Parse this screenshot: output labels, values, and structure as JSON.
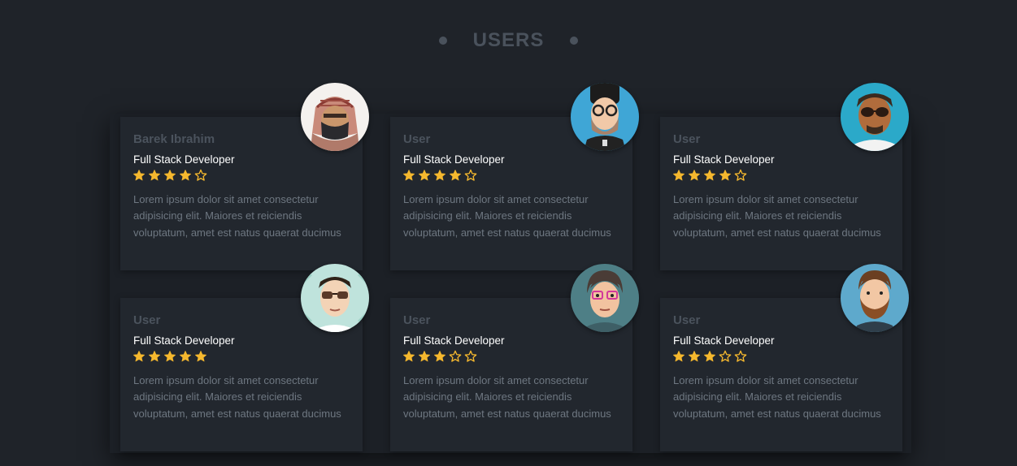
{
  "section": {
    "title": "USERS"
  },
  "colors": {
    "background": "#1f2329",
    "card": "#22272e",
    "star": "#f5b82e",
    "title": "#4a525c"
  },
  "cards": [
    {
      "name": "Barek Ibrahim",
      "role": "Full Stack Developer",
      "rating": 4,
      "max_rating": 5,
      "description": "Lorem ipsum dolor sit amet consectetur adipisicing elit. Maiores et reiciendis voluptatum, amet est natus quaerat ducimus",
      "avatar_icon": "avatar-keffiyeh-icon"
    },
    {
      "name": "User",
      "role": "Full Stack Developer",
      "rating": 4,
      "max_rating": 5,
      "description": "Lorem ipsum dolor sit amet consectetur adipisicing elit. Maiores et reiciendis voluptatum, amet est natus quaerat ducimus",
      "avatar_icon": "avatar-bearded-glasses-icon"
    },
    {
      "name": "User",
      "role": "Full Stack Developer",
      "rating": 4,
      "max_rating": 5,
      "description": "Lorem ipsum dolor sit amet consectetur adipisicing elit. Maiores et reiciendis voluptatum, amet est natus quaerat ducimus",
      "avatar_icon": "avatar-sunglasses-icon"
    },
    {
      "name": "User",
      "role": "Full Stack Developer",
      "rating": 5,
      "max_rating": 5,
      "description": "Lorem ipsum dolor sit amet consectetur adipisicing elit. Maiores et reiciendis voluptatum, amet est natus quaerat ducimus",
      "avatar_icon": "avatar-shades-icon"
    },
    {
      "name": "User",
      "role": "Full Stack Developer",
      "rating": 3,
      "max_rating": 5,
      "description": "Lorem ipsum dolor sit amet consectetur adipisicing elit. Maiores et reiciendis voluptatum, amet est natus quaerat ducimus",
      "avatar_icon": "avatar-pink-glasses-icon"
    },
    {
      "name": "User",
      "role": "Full Stack Developer",
      "rating": 3,
      "max_rating": 5,
      "description": "Lorem ipsum dolor sit amet consectetur adipisicing elit. Maiores et reiciendis voluptatum, amet est natus quaerat ducimus",
      "avatar_icon": "avatar-bearded-man-icon"
    }
  ]
}
